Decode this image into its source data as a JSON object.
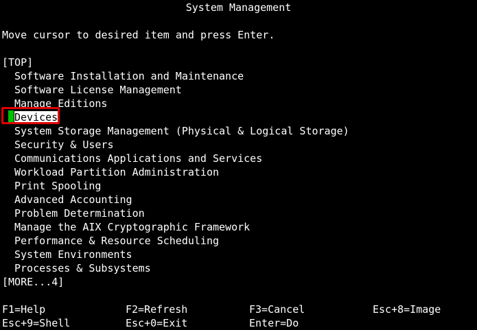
{
  "title": "System Management",
  "instruction": "Move cursor to desired item and press Enter.",
  "top_marker": "[TOP]",
  "menu_items": [
    "Software Installation and Maintenance",
    "Software License Management",
    "Manage Editions",
    "Devices",
    "System Storage Management (Physical & Logical Storage)",
    "Security & Users",
    "Communications Applications and Services",
    "Workload Partition Administration",
    "Print Spooling",
    "Advanced Accounting",
    "Problem Determination",
    "Manage the AIX Cryptographic Framework",
    "Performance & Resource Scheduling",
    "System Environments",
    "Processes & Subsystems"
  ],
  "selected_index": 3,
  "more_marker": "[MORE...4]",
  "function_keys": {
    "f1": "F1=Help",
    "f2": "F2=Refresh",
    "f3": "F3=Cancel",
    "esc8": "Esc+8=Image",
    "esc9": "Esc+9=Shell",
    "esc0": "Esc+0=Exit",
    "enter": "Enter=Do"
  },
  "colors": {
    "background": "#000000",
    "text": "#ffffff",
    "cursor": "#00c000",
    "highlight_border": "#e00000"
  }
}
